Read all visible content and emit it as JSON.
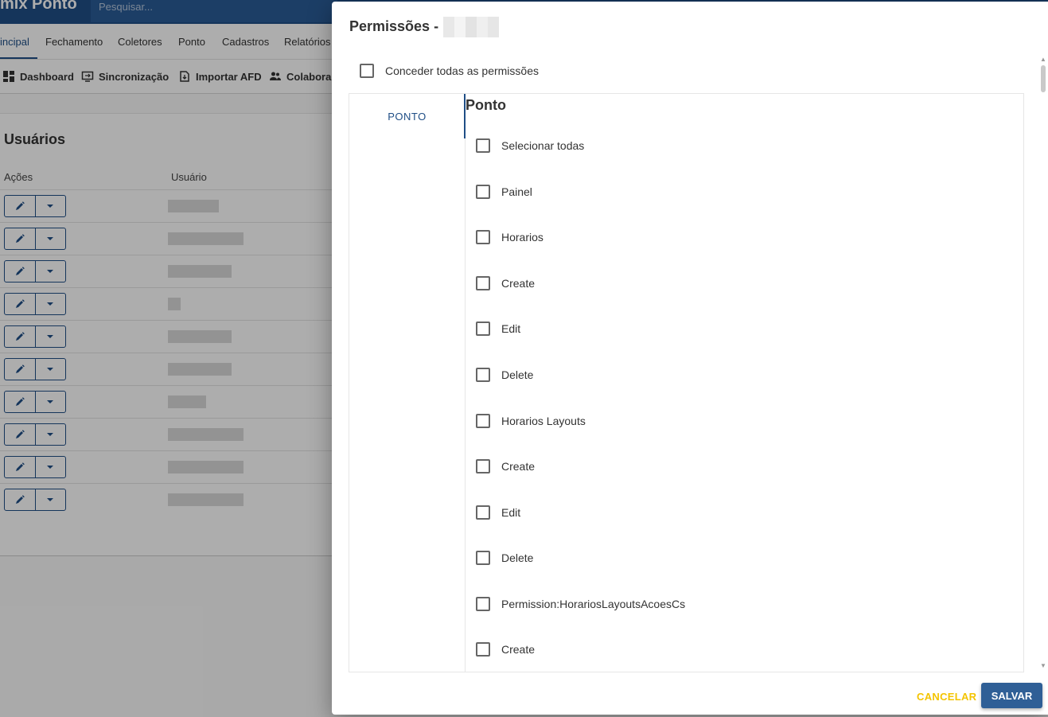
{
  "app": {
    "title": "mix Ponto",
    "search_placeholder": "Pesquisar...",
    "menu": [
      "Principal",
      "Fechamento",
      "Coletores",
      "Ponto",
      "Cadastros",
      "Relatórios"
    ],
    "menu_visible": [
      "incipal",
      "Fechamento",
      "Coletores",
      "Ponto",
      "Cadastros",
      "Relatórios"
    ],
    "toolbar": [
      {
        "label": "Dashboard",
        "icon": "dashboard-icon"
      },
      {
        "label": "Sincronização",
        "icon": "sync-screen-icon"
      },
      {
        "label": "Importar AFD",
        "icon": "import-file-icon"
      },
      {
        "label": "Colabora",
        "icon": "people-icon"
      }
    ],
    "section_title": "Usuários",
    "columns": [
      "Ações",
      "Usuário"
    ],
    "row_count": 10
  },
  "dialog": {
    "title": "Permissões -",
    "grant_all_label": "Conceder todas as permissões",
    "tabs": [
      "PONTO"
    ],
    "section_heading": "Ponto",
    "items": [
      "Selecionar todas",
      "Painel",
      "Horarios",
      "Create",
      "Edit",
      "Delete",
      "Horarios Layouts",
      "Create",
      "Edit",
      "Delete",
      "Permission:HorariosLayoutsAcoesCs",
      "Create"
    ],
    "cancel_label": "CANCELAR",
    "save_label": "SALVAR"
  },
  "colors": {
    "primary": "#1f4e86",
    "save_button": "#2f5f96",
    "cancel_text": "#f4c400"
  }
}
